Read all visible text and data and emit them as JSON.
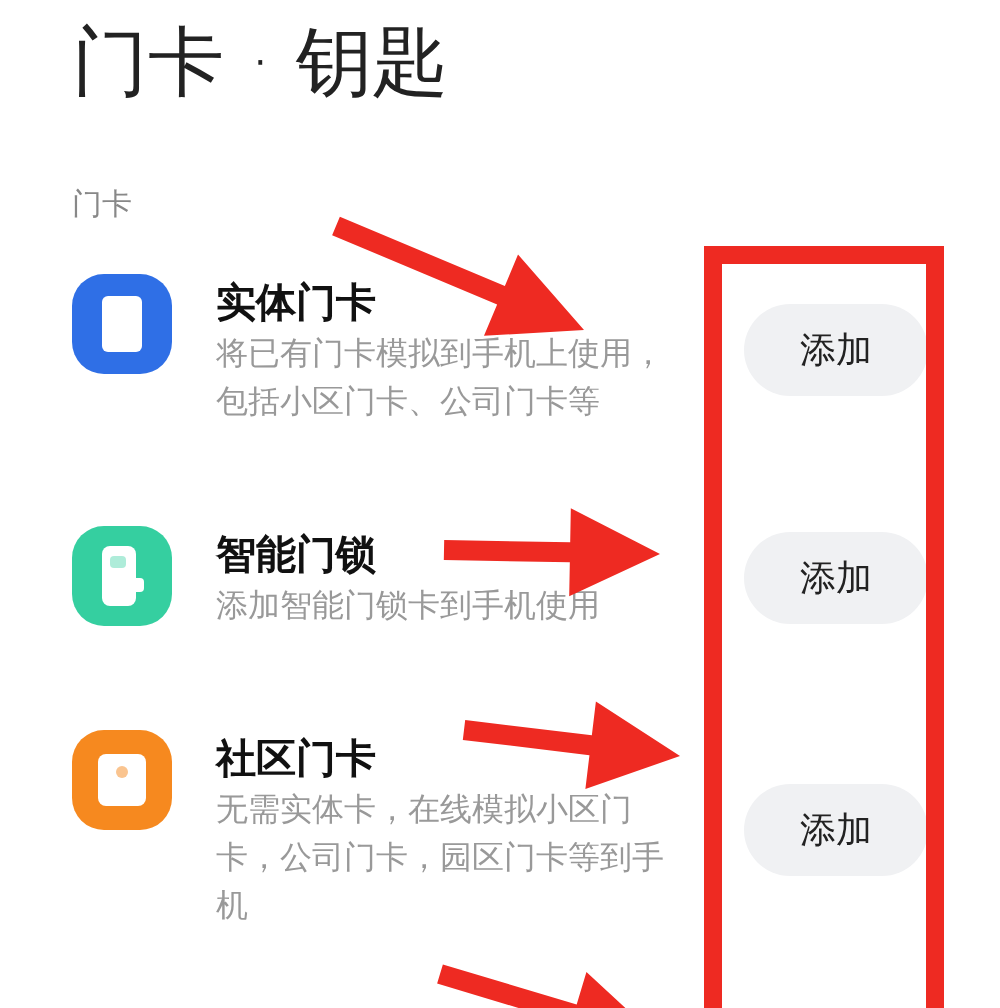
{
  "title": "门卡 · 钥匙",
  "section": "门卡",
  "items": [
    {
      "kind": "card",
      "color": "#2f6fe6",
      "title": "实体门卡",
      "description": "将已有门卡模拟到手机上使用，包括小区门卡、公司门卡等",
      "button": "添加"
    },
    {
      "kind": "lock",
      "color": "#35cfa0",
      "title": "智能门锁",
      "description": "添加智能门锁卡到手机使用",
      "button": "添加"
    },
    {
      "kind": "community",
      "color": "#f6891f",
      "title": "社区门卡",
      "description": "无需实体卡，在线模拟小区门卡，公司门卡，园区门卡等到手机",
      "button": "添加"
    }
  ],
  "annotations": [
    {
      "kind": "arrow"
    },
    {
      "kind": "arrow"
    },
    {
      "kind": "arrow"
    },
    {
      "kind": "arrow"
    },
    {
      "kind": "box"
    }
  ]
}
